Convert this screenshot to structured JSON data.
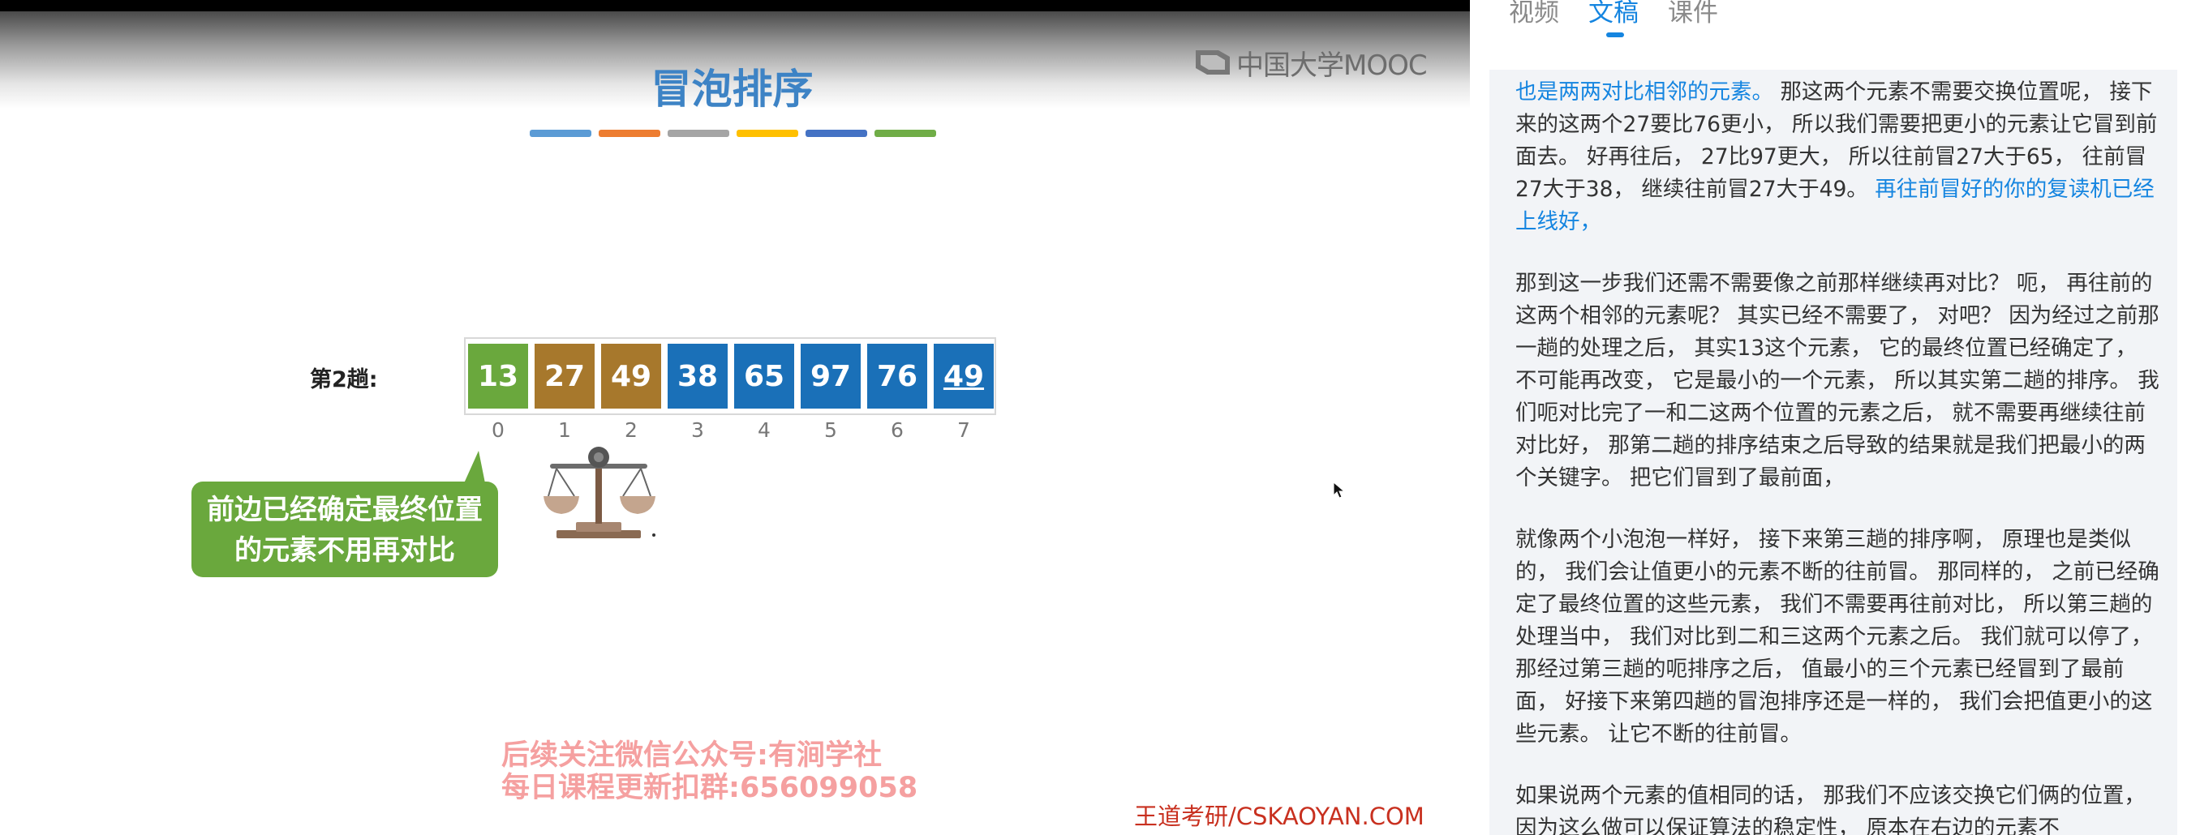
{
  "video": {
    "logo": "中国大学MOOC",
    "slide_title": "冒泡排序",
    "color_bar": [
      "#5b9bd5",
      "#ed7d31",
      "#a5a5a5",
      "#ffc000",
      "#4472c4",
      "#70ad47"
    ],
    "pass_label": "第2趟:",
    "cells": [
      {
        "value": "13",
        "state": "green"
      },
      {
        "value": "27",
        "state": "brown"
      },
      {
        "value": "49",
        "state": "brown"
      },
      {
        "value": "38",
        "state": "blue"
      },
      {
        "value": "65",
        "state": "blue"
      },
      {
        "value": "97",
        "state": "blue"
      },
      {
        "value": "76",
        "state": "blue"
      },
      {
        "value": "49",
        "state": "blue",
        "underlined": true
      }
    ],
    "indices": [
      "0",
      "1",
      "2",
      "3",
      "4",
      "5",
      "6",
      "7"
    ],
    "callout_line1": "前边已经确定最终位置",
    "callout_line2": "的元素不用再对比",
    "watermark_line1": "后续关注微信公众号:有涧学社",
    "watermark_line2": "每日课程更新扣群:656099058",
    "brand": "王道考研/CSKAOYAN.COM"
  },
  "panel": {
    "tabs": [
      "视频",
      "文稿",
      "课件"
    ],
    "active_tab": "文稿",
    "transcript": {
      "p1_highlight_start": "也是两两对比相邻的元素。",
      "p1_text": "那这两个元素不需要交换位置呢， 接下来的这两个27要比76更小， 所以我们需要把更小的元素让它冒到前面去。 好再往后， 27比97更大， 所以往前冒27大于65， 往前冒27大于38， 继续往前冒27大于49。",
      "p1_highlight_end": "再往前冒好的你的复读机已经上线好，",
      "p2": "那到这一步我们还需不需要像之前那样继续再对比？ 呃， 再往前的这两个相邻的元素呢？ 其实已经不需要了， 对吧？ 因为经过之前那一趟的处理之后， 其实13这个元素， 它的最终位置已经确定了， 不可能再改变， 它是最小的一个元素， 所以其实第二趟的排序。 我们呃对比完了一和二这两个位置的元素之后， 就不需要再继续往前对比好， 那第二趟的排序结束之后导致的结果就是我们把最小的两个关键字。 把它们冒到了最前面，",
      "p3": "就像两个小泡泡一样好， 接下来第三趟的排序啊， 原理也是类似的， 我们会让值更小的元素不断的往前冒。 那同样的， 之前已经确定了最终位置的这些元素， 我们不需要再往前对比， 所以第三趟的处理当中， 我们对比到二和三这两个元素之后。 我们就可以停了， 那经过第三趟的呃排序之后， 值最小的三个元素已经冒到了最前面， 好接下来第四趟的冒泡排序还是一样的， 我们会把值更小的这些元素。 让它不断的往前冒。",
      "p4": "如果说两个元素的值相同的话， 那我们不应该交换它们俩的位置， 因为这么做可以保证算法的稳定性， 原本在右边的元素不"
    }
  }
}
